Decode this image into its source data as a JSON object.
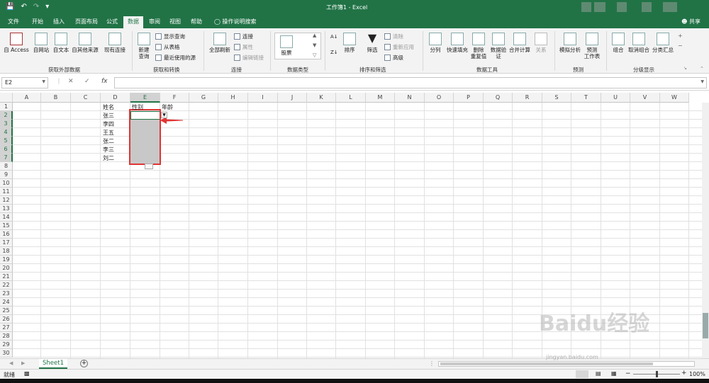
{
  "window": {
    "title": "工作簿1 - Excel"
  },
  "quick_access": {
    "save_icon": "save-icon",
    "undo_icon": "undo-icon",
    "redo_icon": "redo-icon",
    "customize_icon": "customize-icon"
  },
  "tabs": [
    {
      "label": "文件"
    },
    {
      "label": "开始"
    },
    {
      "label": "插入"
    },
    {
      "label": "页面布局"
    },
    {
      "label": "公式"
    },
    {
      "label": "数据"
    },
    {
      "label": "审阅"
    },
    {
      "label": "视图"
    },
    {
      "label": "帮助"
    }
  ],
  "tell_me": "操作说明搜索",
  "share": "共享",
  "ribbon": {
    "get_external": {
      "access": "自 Access",
      "web": "自网站",
      "text": "自文本",
      "other": "自其他来源",
      "existing": "现有连接",
      "group": "获取外部数据"
    },
    "get_transform": {
      "new_query": "新建\n查询",
      "show_queries": "显示查询",
      "from_table": "从表格",
      "recent_sources": "最近使用的源",
      "group": "获取和转换"
    },
    "connections": {
      "refresh_all": "全部刷新",
      "connections": "连接",
      "properties": "属性",
      "edit_links": "编辑链接",
      "group": "连接"
    },
    "data_types": {
      "stocks": "股票",
      "group": "数据类型"
    },
    "sort_filter": {
      "sort": "排序",
      "filter": "筛选",
      "clear": "清除",
      "reapply": "重新应用",
      "advanced": "高级",
      "group": "排序和筛选"
    },
    "data_tools": {
      "text_to_columns": "分列",
      "flash_fill": "快速填充",
      "remove_duplicates": "删除\n重复值",
      "data_validation": "数据验\n证",
      "consolidate": "合并计算",
      "relationships": "关系",
      "group": "数据工具"
    },
    "forecast": {
      "what_if": "模拟分析",
      "forecast_sheet": "预测\n工作表",
      "group": "预测"
    },
    "outline": {
      "group_btn": "组合",
      "ungroup": "取消组合",
      "subtotal": "分类汇总",
      "group": "分级显示"
    }
  },
  "formula_bar": {
    "name_box": "E2",
    "cancel": "✕",
    "confirm": "✓",
    "fx": "fx",
    "formula": ""
  },
  "columns": [
    "A",
    "B",
    "C",
    "D",
    "E",
    "F",
    "G",
    "H",
    "I",
    "J",
    "K",
    "L",
    "M",
    "N",
    "O",
    "P",
    "Q",
    "R",
    "S",
    "T",
    "U",
    "V",
    "W"
  ],
  "rows": [
    "1",
    "2",
    "3",
    "4",
    "5",
    "6",
    "7",
    "8",
    "9",
    "10",
    "11",
    "12",
    "13",
    "14",
    "15",
    "16",
    "17",
    "18",
    "19",
    "20",
    "21",
    "22",
    "23",
    "24",
    "25",
    "26",
    "27",
    "28",
    "29",
    "30"
  ],
  "cells": {
    "D1": "姓名",
    "E1": "性别",
    "F1": "年龄",
    "D2": "张三",
    "D3": "李四",
    "D4": "王五",
    "D5": "张二",
    "D6": "李三",
    "D7": "刘二"
  },
  "sheet_tabs": [
    {
      "label": "Sheet1",
      "active": true
    }
  ],
  "status": {
    "ready": "就绪",
    "zoom": "100%"
  },
  "watermark": {
    "text": "Baidu经验",
    "sub": "jingyan.baidu.com"
  }
}
